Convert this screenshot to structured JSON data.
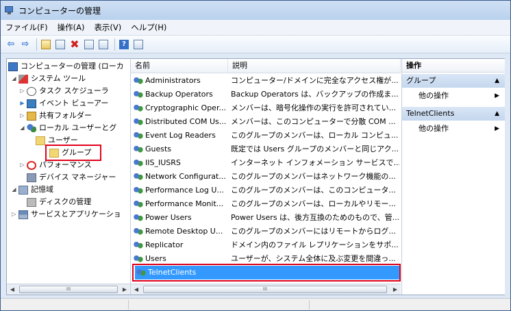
{
  "window": {
    "title": "コンピューターの管理"
  },
  "menu": {
    "items": [
      "ファイル(F)",
      "操作(A)",
      "表示(V)",
      "ヘルプ(H)"
    ]
  },
  "toolbar": {
    "icons": [
      "back-arrow-icon",
      "forward-arrow-icon",
      "up-folder-icon",
      "show-hide-tree-icon",
      "delete-icon",
      "properties-icon",
      "export-list-icon",
      "help-icon",
      "show-hide-action-pane-icon"
    ]
  },
  "tree": {
    "items": [
      {
        "label": "コンピューターの管理 (ローカ",
        "icon": "computer-icon"
      },
      {
        "label": "システム ツール",
        "icon": "tools-icon"
      },
      {
        "label": "タスク スケジューラ",
        "icon": "clock-icon"
      },
      {
        "label": "イベント ビューアー",
        "icon": "event-viewer-icon"
      },
      {
        "label": "共有フォルダー",
        "icon": "shared-folder-icon"
      },
      {
        "label": "ローカル ユーザーとグ",
        "icon": "users-icon"
      },
      {
        "label": "ユーザー",
        "icon": "folder-icon"
      },
      {
        "label": "グループ",
        "icon": "folder-icon"
      },
      {
        "label": "パフォーマンス",
        "icon": "performance-icon"
      },
      {
        "label": "デバイス マネージャー",
        "icon": "device-manager-icon"
      },
      {
        "label": "記憶域",
        "icon": "storage-icon"
      },
      {
        "label": "ディスクの管理",
        "icon": "disk-icon"
      },
      {
        "label": "サービスとアプリケーショ",
        "icon": "services-icon"
      }
    ]
  },
  "list": {
    "columns": [
      "名前",
      "説明"
    ],
    "rows": [
      {
        "name": "Administrators",
        "desc": "コンピューター/ドメインに完全なアクセス権が..."
      },
      {
        "name": "Backup Operators",
        "desc": "Backup Operators は、バックアップの作成ま..."
      },
      {
        "name": "Cryptographic Oper...",
        "desc": "メンバーは、暗号化操作の実行を許可されてい..."
      },
      {
        "name": "Distributed COM Us...",
        "desc": "メンバーは、このコンピューターで分散 COM ..."
      },
      {
        "name": "Event Log Readers",
        "desc": "このグループのメンバーは、ローカル コンピュ..."
      },
      {
        "name": "Guests",
        "desc": "既定では Users グループのメンバーと同じアク..."
      },
      {
        "name": "IIS_IUSRS",
        "desc": "インターネット インフォメーション サービスで..."
      },
      {
        "name": "Network Configurat...",
        "desc": "このグループのメンバーはネットワーク機能の..."
      },
      {
        "name": "Performance Log U...",
        "desc": "このグループのメンバーは、このコンピュータ..."
      },
      {
        "name": "Performance Monit...",
        "desc": "このグループのメンバーは、ローカルやリモー..."
      },
      {
        "name": "Power Users",
        "desc": "Power Users は、後方互換のためのもので、管..."
      },
      {
        "name": "Remote Desktop U...",
        "desc": "このグループのメンバーにはリモートからログ..."
      },
      {
        "name": "Replicator",
        "desc": "ドメイン内のファイル レプリケーションをサポ..."
      },
      {
        "name": "Users",
        "desc": "ユーザーが、システム全体に及ぶ変更を間違っ..."
      },
      {
        "name": "TelnetClients",
        "desc": ""
      }
    ],
    "selected_index": 14
  },
  "actions": {
    "title": "操作",
    "groups": [
      {
        "label": "グループ",
        "item": "他の操作"
      },
      {
        "label": "TelnetClients",
        "item": "他の操作"
      }
    ]
  },
  "scrollbar": {
    "thumb_glyph": "III"
  },
  "colors": {
    "selection": "#3399ff",
    "highlight_box": "#e0001a"
  }
}
